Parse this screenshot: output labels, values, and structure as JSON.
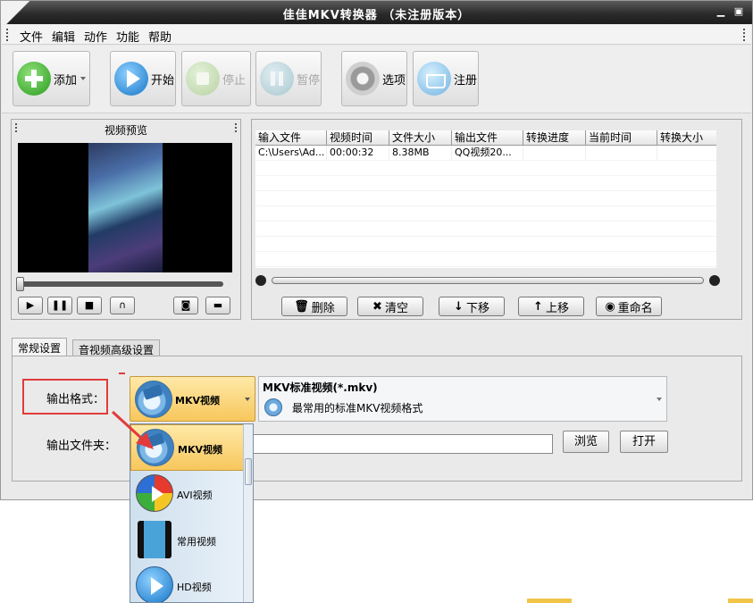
{
  "window": {
    "title": "佳佳MKV转换器  （未注册版本）",
    "min_glyph": "▁",
    "close_glyph": "▣"
  },
  "menu": {
    "items": [
      "文件",
      "编辑",
      "动作",
      "功能",
      "帮助"
    ]
  },
  "toolbar": {
    "add": "添加",
    "start": "开始",
    "stop": "停止",
    "pause": "暂停",
    "options": "选项",
    "register": "注册"
  },
  "preview": {
    "title": "视频预览",
    "controls": [
      "▶",
      "❚❚",
      "■",
      "∩",
      "◙",
      "▬"
    ]
  },
  "file_list": {
    "columns": [
      "输入文件",
      "视频时间",
      "文件大小",
      "输出文件",
      "转换进度",
      "当前时间",
      "转换大小"
    ],
    "rows": [
      [
        "C:\\Users\\Ad...",
        "00:00:32",
        "8.38MB",
        "QQ视频20...",
        "",
        "",
        ""
      ]
    ],
    "actions": {
      "delete": "删除",
      "clear": "清空",
      "down": "下移",
      "up": "上移",
      "rename": "重命名"
    }
  },
  "tabs": [
    "常规设置",
    "音视频高级设置"
  ],
  "settings": {
    "format_label": "输出格式：",
    "folder_label": "输出文件夹：",
    "selected_format": "MKV视频",
    "format_title": "MKV标准视频(*.mkv)",
    "format_desc": "最常用的标准MKV视频格式",
    "browse": "浏览",
    "open": "打开"
  },
  "dropdown": {
    "items": [
      "MKV视频",
      "AVI视频",
      "常用视频",
      "HD视频"
    ]
  },
  "colors": {
    "title_bg": "#2b2b2b",
    "highlight": "#f7c75c",
    "annotation_red": "#e23b3b"
  }
}
